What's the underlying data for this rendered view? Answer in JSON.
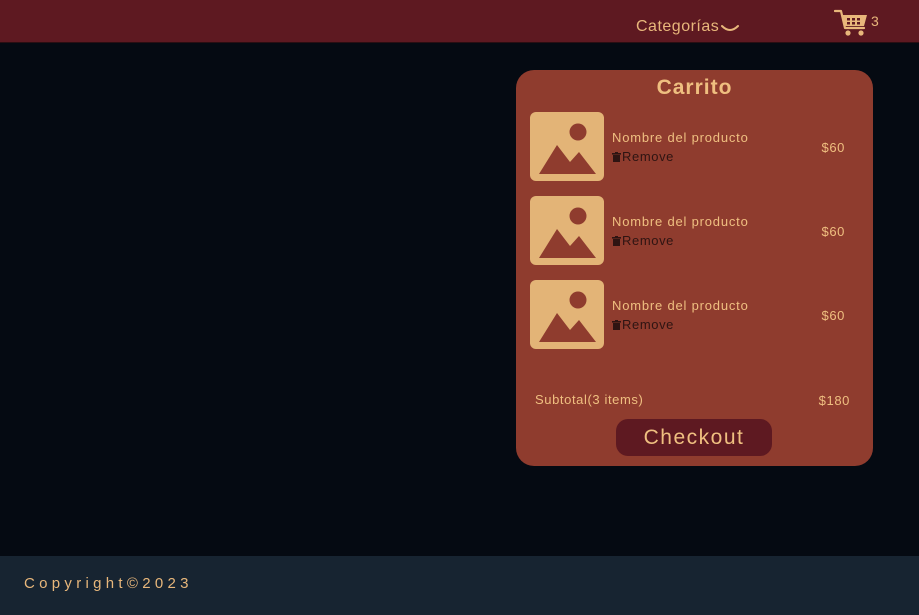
{
  "header": {
    "categories_label": "Categorías",
    "cart_icon": "shopping-cart-icon",
    "cart_count": "3"
  },
  "cart": {
    "title": "Carrito",
    "items": [
      {
        "name": "Nombre del producto",
        "remove_label": "Remove",
        "price": "$60",
        "image_icon": "image-placeholder-icon"
      },
      {
        "name": "Nombre del producto",
        "remove_label": "Remove",
        "price": "$60",
        "image_icon": "image-placeholder-icon"
      },
      {
        "name": "Nombre del producto",
        "remove_label": "Remove",
        "price": "$60",
        "image_icon": "image-placeholder-icon"
      }
    ],
    "subtotal_label": "Subtotal(3 items)",
    "subtotal_value": "$180",
    "checkout_label": "Checkout"
  },
  "footer": {
    "copyright": "Copyright©2023"
  },
  "colors": {
    "header_bg": "#5e1921",
    "page_bg": "#050a12",
    "panel_bg": "#8f3c2e",
    "accent_text": "#efbf80",
    "thumb_bg": "#e3b477",
    "footer_bg": "#172431"
  }
}
